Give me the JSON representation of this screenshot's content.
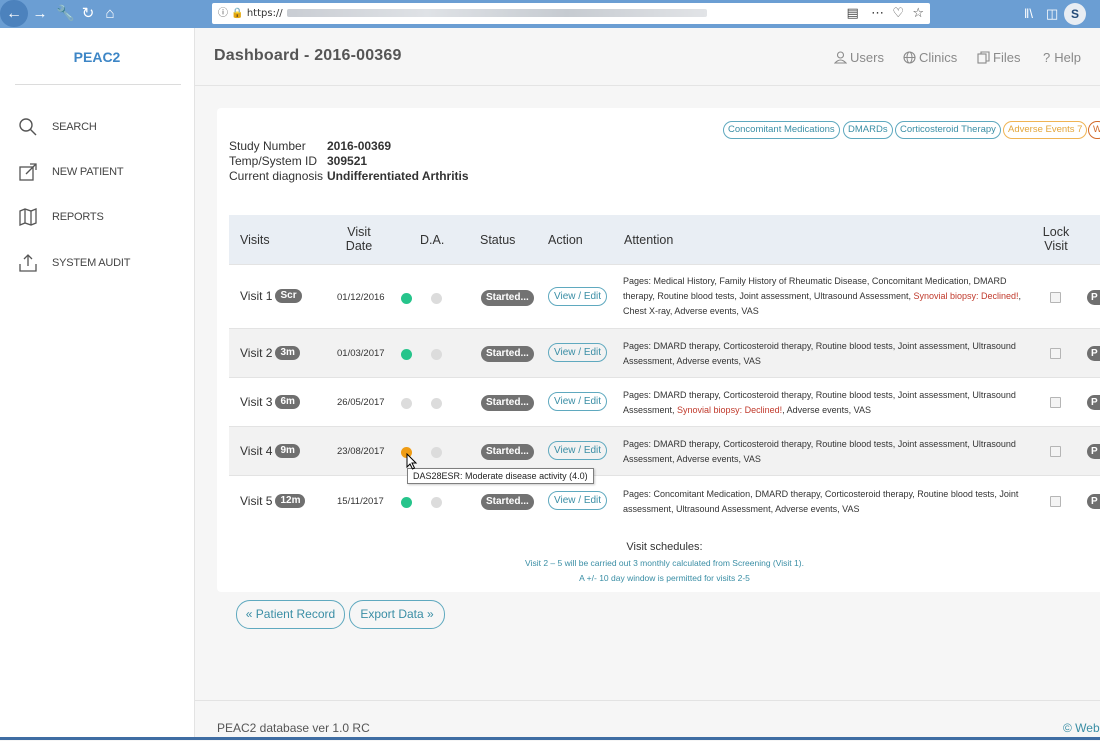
{
  "browser": {
    "url_prefix": "https://"
  },
  "brand": "PEAC2",
  "sidebar": {
    "items": [
      {
        "label": "SEARCH",
        "icon": "search-icon"
      },
      {
        "label": "NEW PATIENT",
        "icon": "external-link-icon"
      },
      {
        "label": "REPORTS",
        "icon": "map-icon"
      },
      {
        "label": "SYSTEM AUDIT",
        "icon": "upload-icon"
      }
    ]
  },
  "header": {
    "title": "Dashboard - 2016-00369",
    "nav": {
      "users": "Users",
      "clinics": "Clinics",
      "files": "Files",
      "help": "Help"
    }
  },
  "tags": [
    "Concomitant Medications",
    "DMARDs",
    "Corticosteroid Therapy",
    "Adverse Events 7",
    "W"
  ],
  "patient": {
    "study_label": "Study Number",
    "study_value": "2016-00369",
    "temp_label": "Temp/System ID",
    "temp_value": "309521",
    "diag_label": "Current diagnosis",
    "diag_value": "Undifferentiated Arthritis"
  },
  "table": {
    "headers": {
      "visits": "Visits",
      "visit_date": "Visit Date",
      "da": "D.A.",
      "status": "Status",
      "action": "Action",
      "attention": "Attention",
      "lock": "Lock Visit"
    },
    "rows": [
      {
        "visit": "Visit 1",
        "badge": "Scr",
        "date": "01/12/2016",
        "status": "Started...",
        "action": "View / Edit",
        "attn_pre": "Pages: Medical History, Family History of Rheumatic Disease, Concomitant Medication, DMARD therapy, Routine blood tests, Joint assessment, Ultrasound Assessment, ",
        "attn_red": "Synovial biopsy: Declined!",
        "attn_post": ", Chest X-ray, Adverse events, VAS",
        "p": "P"
      },
      {
        "visit": "Visit 2",
        "badge": "3m",
        "date": "01/03/2017",
        "status": "Started...",
        "action": "View / Edit",
        "attn_pre": "Pages: DMARD therapy, Corticosteroid therapy, Routine blood tests, Joint assessment, Ultrasound Assessment, Adverse events, VAS",
        "attn_red": "",
        "attn_post": "",
        "p": "P"
      },
      {
        "visit": "Visit 3",
        "badge": "6m",
        "date": "26/05/2017",
        "status": "Started...",
        "action": "View / Edit",
        "attn_pre": "Pages: DMARD therapy, Corticosteroid therapy, Routine blood tests, Joint assessment, Ultrasound Assessment, ",
        "attn_red": "Synovial biopsy: Declined!",
        "attn_post": ", Adverse events, VAS",
        "p": "P"
      },
      {
        "visit": "Visit 4",
        "badge": "9m",
        "date": "23/08/2017",
        "status": "Started...",
        "action": "View / Edit",
        "attn_pre": "Pages: DMARD therapy, Corticosteroid therapy, Routine blood tests, Joint assessment, Ultrasound Assessment, Adverse events, VAS",
        "attn_red": "",
        "attn_post": "",
        "p": "P"
      },
      {
        "visit": "Visit 5",
        "badge": "12m",
        "date": "15/11/2017",
        "status": "Started...",
        "action": "View / Edit",
        "attn_pre": "Pages: Concomitant Medication, DMARD therapy, Corticosteroid therapy, Routine blood tests, Joint assessment, Ultrasound Assessment, Adverse events, VAS",
        "attn_red": "",
        "attn_post": "",
        "p": "P"
      }
    ],
    "tooltip": "DAS28ESR: Moderate disease activity (4.0)"
  },
  "schedule": {
    "title": "Visit schedules:",
    "line1": "Visit 2 – 5 will be carried out 3 monthly calculated from Screening (Visit 1).",
    "line2": "A +/- 10 day window is permitted for visits 2-5"
  },
  "buttons": {
    "patient_record": "« Patient Record",
    "export": "Export Data »"
  },
  "footer": {
    "version": "PEAC2 database ver 1.0 RC",
    "right": "© Web"
  },
  "colors": {
    "accent": "#3d86c6",
    "teal": "#5fa9bf",
    "green_dot": "#26c48b",
    "orange_dot": "#ef9c14",
    "red_text": "#c0392b"
  }
}
